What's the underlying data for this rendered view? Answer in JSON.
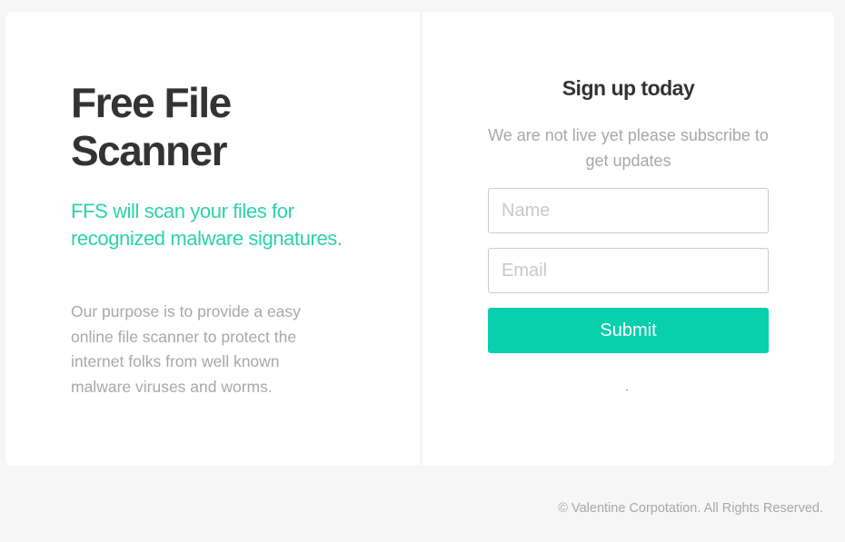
{
  "hero": {
    "title": "Free File Scanner",
    "tagline": "FFS will scan your files for recognized malware signatures.",
    "description": "Our purpose is to provide a easy online file scanner to protect the internet folks from well known malware viruses and worms."
  },
  "signup": {
    "title": "Sign up today",
    "subtitle": "We are not live yet please subscribe to get updates",
    "name_placeholder": "Name",
    "email_placeholder": "Email",
    "submit_label": "Submit"
  },
  "footer": {
    "copyright": "© Valentine Corpotation. All Rights Reserved."
  },
  "colors": {
    "accent": "#08cfac",
    "tagline": "#2bd3a8",
    "heading": "#333333",
    "muted": "#a8a8a8",
    "background": "#f6f6f6"
  }
}
